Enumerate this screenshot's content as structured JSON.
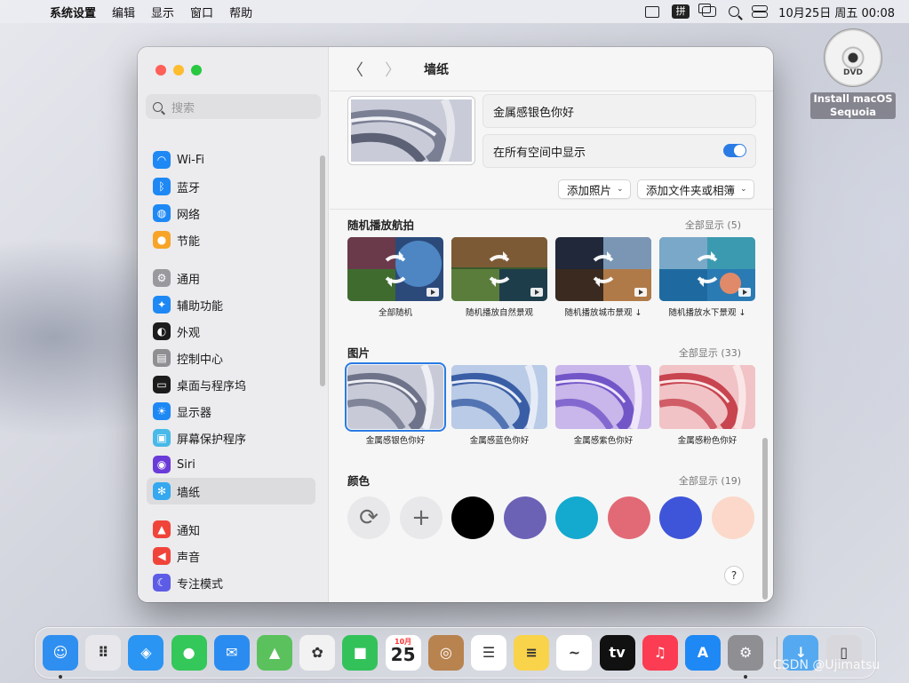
{
  "menubar": {
    "app_name": "系统设置",
    "items": [
      "编辑",
      "显示",
      "窗口",
      "帮助"
    ],
    "input_method": "拼",
    "clock": "10月25日 周五  00:08"
  },
  "desktop": {
    "dvd_label_1": "Install macOS",
    "dvd_label_2": "Sequoia",
    "dvd_disc_text": "DVD"
  },
  "sidebar": {
    "search_placeholder": "搜索",
    "groups": [
      [
        {
          "label": "Wi-Fi",
          "icon": "wifi-icon",
          "color": "#1e88f5",
          "glyph": "◠"
        },
        {
          "label": "蓝牙",
          "icon": "bluetooth-icon",
          "color": "#1e88f5",
          "glyph": "ᛒ"
        },
        {
          "label": "网络",
          "icon": "globe-icon",
          "color": "#1e88f5",
          "glyph": "◍"
        },
        {
          "label": "节能",
          "icon": "bulb-icon",
          "color": "#f7a428",
          "glyph": "●"
        }
      ],
      [
        {
          "label": "通用",
          "icon": "gear-icon",
          "color": "#9a9a9e",
          "glyph": "⚙"
        },
        {
          "label": "辅助功能",
          "icon": "accessibility-icon",
          "color": "#1e88f5",
          "glyph": "✦"
        },
        {
          "label": "外观",
          "icon": "appearance-icon",
          "color": "#1c1c1c",
          "glyph": "◐"
        },
        {
          "label": "控制中心",
          "icon": "control-center-icon",
          "color": "#8e8e93",
          "glyph": "▤"
        },
        {
          "label": "桌面与程序坞",
          "icon": "dock-icon",
          "color": "#1c1c1c",
          "glyph": "▭"
        },
        {
          "label": "显示器",
          "icon": "display-icon",
          "color": "#1e88f5",
          "glyph": "☀"
        },
        {
          "label": "屏幕保护程序",
          "icon": "screensaver-icon",
          "color": "#48b9e8",
          "glyph": "▣"
        },
        {
          "label": "Siri",
          "icon": "siri-icon",
          "color": "#6a3bd8",
          "glyph": "◉"
        },
        {
          "label": "墙纸",
          "icon": "wallpaper-icon",
          "color": "#35a8f0",
          "glyph": "✻",
          "active": true
        }
      ],
      [
        {
          "label": "通知",
          "icon": "bell-icon",
          "color": "#f0443a",
          "glyph": "▲"
        },
        {
          "label": "声音",
          "icon": "speaker-icon",
          "color": "#f0443a",
          "glyph": "◀"
        },
        {
          "label": "专注模式",
          "icon": "moon-icon",
          "color": "#5d5ce6",
          "glyph": "☾"
        }
      ]
    ]
  },
  "toolbar": {
    "back": "〈",
    "forward": "〉",
    "title": "墙纸"
  },
  "current": {
    "name": "金属感银色你好",
    "show_all_spaces_label": "在所有空间中显示",
    "show_all_spaces_on": true,
    "add_photo": "添加照片",
    "add_folder": "添加文件夹或相簿"
  },
  "aerials": {
    "title": "随机播放航拍",
    "show_all": "全部显示 (5)",
    "items": [
      "全部随机",
      "随机播放自然景观",
      "随机播放城市景观 ↓",
      "随机播放水下景观 ↓"
    ]
  },
  "pictures": {
    "title": "图片",
    "show_all": "全部显示 (33)",
    "items": [
      "金属感银色你好",
      "金属感蓝色你好",
      "金属感紫色你好",
      "金属感粉色你好"
    ]
  },
  "colors": {
    "title": "颜色",
    "show_all": "全部显示 (19)",
    "swatches": [
      "#000000",
      "#6b62b6",
      "#14a9cf",
      "#e16a76",
      "#3e55d9",
      "#fbd8c9"
    ]
  },
  "help_label": "?",
  "dock": {
    "apps": [
      {
        "name": "finder-app",
        "color": "#2f8ff0",
        "glyph": "☺"
      },
      {
        "name": "launchpad-app",
        "color": "#e8e8ec",
        "glyph": "⠿"
      },
      {
        "name": "safari-app",
        "color": "#2a95f3",
        "glyph": "◈"
      },
      {
        "name": "messages-app",
        "color": "#34c759",
        "glyph": "●"
      },
      {
        "name": "mail-app",
        "color": "#2a8cf0",
        "glyph": "✉"
      },
      {
        "name": "maps-app",
        "color": "#5ac15c",
        "glyph": "▲"
      },
      {
        "name": "photos-app",
        "color": "#f2f2f2",
        "glyph": "✿"
      },
      {
        "name": "facetime-app",
        "color": "#33c25a",
        "glyph": "■"
      },
      {
        "name": "calendar-app",
        "color": "#ffffff",
        "glyph": "25"
      },
      {
        "name": "contacts-app",
        "color": "#b8834f",
        "glyph": "◎"
      },
      {
        "name": "reminders-app",
        "color": "#ffffff",
        "glyph": "☰"
      },
      {
        "name": "notes-app",
        "color": "#f9d34a",
        "glyph": "≡"
      },
      {
        "name": "freeform-app",
        "color": "#ffffff",
        "glyph": "~"
      },
      {
        "name": "tv-app",
        "color": "#111111",
        "glyph": "tv"
      },
      {
        "name": "music-app",
        "color": "#fb3c52",
        "glyph": "♫"
      },
      {
        "name": "appstore-app",
        "color": "#1e88f5",
        "glyph": "A"
      },
      {
        "name": "system-settings-app",
        "color": "#8e8e93",
        "glyph": "⚙"
      },
      {
        "name": "downloads-folder",
        "color": "#55a9f0",
        "glyph": "↓"
      },
      {
        "name": "trash-app",
        "color": "#d8d8dc",
        "glyph": "▯"
      }
    ],
    "calendar_month": "10月"
  },
  "watermark": "CSDN @Ujimatsu"
}
